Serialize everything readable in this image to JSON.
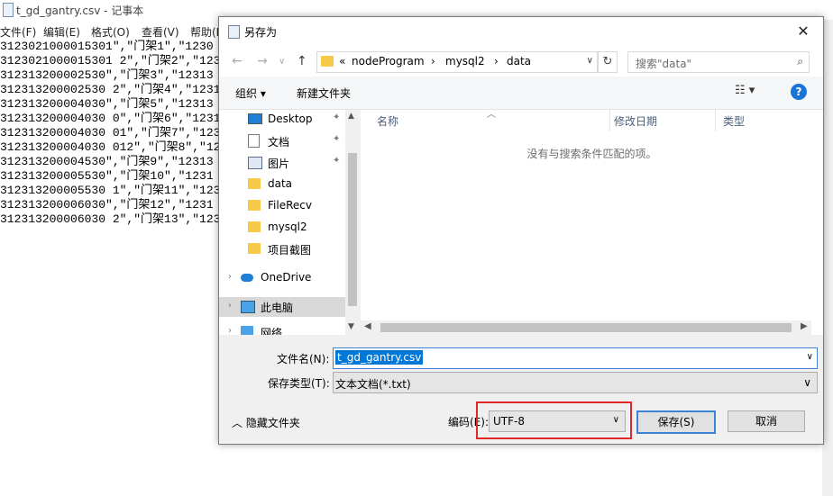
{
  "notepad": {
    "title": "t_gd_gantry.csv - 记事本",
    "menu": [
      "文件(F)",
      "编辑(E)",
      "格式(O)",
      "查看(V)",
      "帮助(H)"
    ],
    "lines": [
      "3123021000015301\",\"门架1\",\"1230",
      "3123021000015301 2\",\"门架2\",\"123",
      "312313200002530\",\"门架3\",\"12313",
      "312313200002530 2\",\"门架4\",\"1231",
      "312313200004030\",\"门架5\",\"12313",
      "312313200004030 0\",\"门架6\",\"1231",
      "312313200004030 01\",\"门架7\",\"123",
      "312313200004030 012\",\"门架8\",\"12",
      "312313200004530\",\"门架9\",\"12313",
      "312313200005530\",\"门架10\",\"1231",
      "312313200005530 1\",\"门架11\",\"123",
      "312313200006030\",\"门架12\",\"1231",
      "312313200006030 2\",\"门架13\",\"123"
    ]
  },
  "dialog": {
    "title": "另存为",
    "close": "✕",
    "address": {
      "chevron": "«",
      "parts": [
        "nodeProgram",
        "mysql2",
        "data"
      ],
      "sep": "›"
    },
    "search_placeholder": "搜索\"data\"",
    "toolbar": {
      "organize": "组织 ▾",
      "new_folder": "新建文件夹",
      "view": "☷ ▾",
      "help": "?"
    },
    "nav": [
      {
        "label": "Desktop",
        "icon": "desktop-icon",
        "pinned": true
      },
      {
        "label": "文档",
        "icon": "document-icon",
        "pinned": true
      },
      {
        "label": "图片",
        "icon": "picture-icon",
        "pinned": true
      },
      {
        "label": "data",
        "icon": "folder-icon",
        "pinned": false
      },
      {
        "label": "FileRecv",
        "icon": "folder-icon",
        "pinned": false
      },
      {
        "label": "mysql2",
        "icon": "folder-icon",
        "pinned": false
      },
      {
        "label": "项目截图",
        "icon": "folder-icon",
        "pinned": false
      },
      {
        "label": "OneDrive",
        "icon": "cloud-icon",
        "pinned": false
      },
      {
        "label": "此电脑",
        "icon": "computer-icon",
        "pinned": false
      },
      {
        "label": "网络",
        "icon": "network-icon",
        "pinned": false
      }
    ],
    "columns": [
      "名称",
      "修改日期",
      "类型"
    ],
    "empty_message": "没有与搜索条件匹配的项。",
    "filename_label": "文件名(N):",
    "filename_value": "t_gd_gantry.csv",
    "filetype_label": "保存类型(T):",
    "filetype_value": "文本文档(*.txt)",
    "hide_folders": "隐藏文件夹",
    "encoding_label": "编码(E):",
    "encoding_value": "UTF-8",
    "save": "保存(S)",
    "cancel": "取消",
    "colors": {
      "accent": "#0078d7",
      "highlight": "#e02a2a"
    }
  }
}
